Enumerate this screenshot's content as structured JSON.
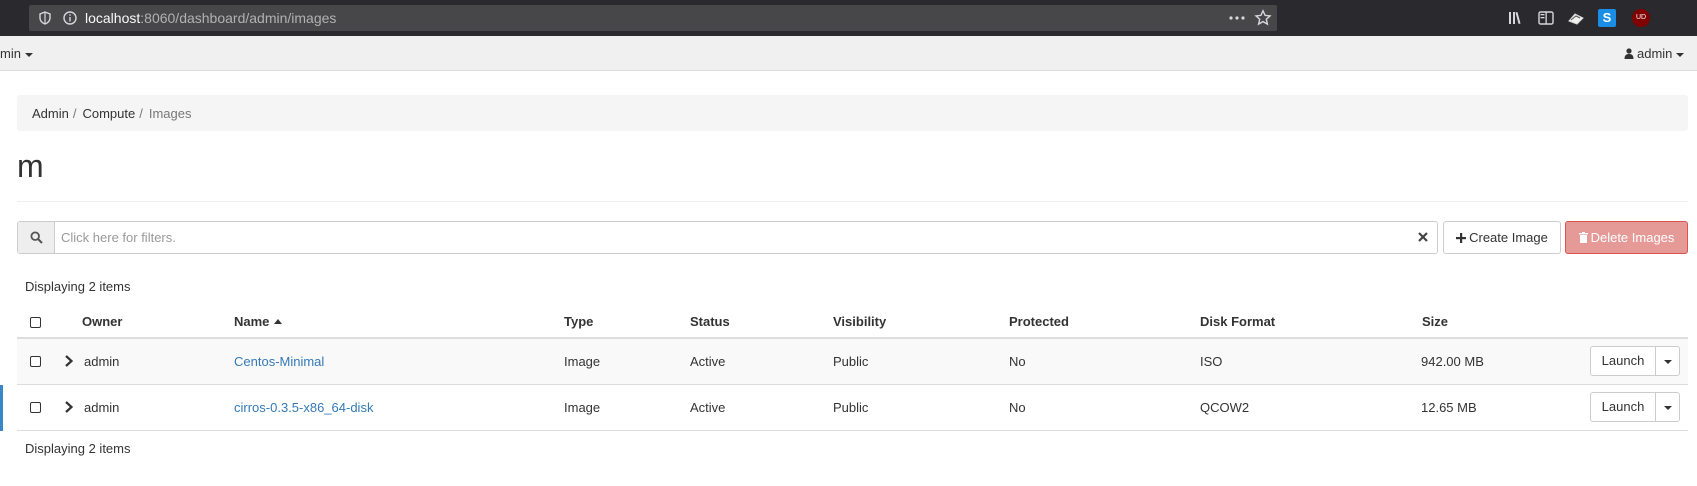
{
  "browser": {
    "url_host": "localhost",
    "url_rest": ":8060/dashboard/admin/images",
    "icons": [
      "shield-icon",
      "info-icon",
      "more-icon",
      "star-icon",
      "library-icon",
      "sidebar-icon",
      "extension-icon",
      "s-extension-icon",
      "ublock-icon"
    ],
    "ublock_badge": "UD"
  },
  "navbar": {
    "project_label": "min",
    "user_label": "admin"
  },
  "breadcrumb": {
    "items": [
      "Admin",
      "Compute",
      "Images"
    ]
  },
  "page": {
    "title": "m"
  },
  "filter": {
    "placeholder": "Click here for filters."
  },
  "actions": {
    "create_label": "Create Image",
    "delete_label": "Delete Images"
  },
  "table": {
    "count_label": "Displaying 2 items",
    "columns": [
      "Owner",
      "Name",
      "Type",
      "Status",
      "Visibility",
      "Protected",
      "Disk Format",
      "Size"
    ],
    "sorted_column": "Name",
    "rows": [
      {
        "owner": "admin",
        "name": "Centos-Minimal",
        "type": "Image",
        "status": "Active",
        "visibility": "Public",
        "protected": "No",
        "disk_format": "ISO",
        "size": "942.00 MB",
        "action": "Launch"
      },
      {
        "owner": "admin",
        "name": "cirros-0.3.5-x86_64-disk",
        "type": "Image",
        "status": "Active",
        "visibility": "Public",
        "protected": "No",
        "disk_format": "QCOW2",
        "size": "12.65 MB",
        "action": "Launch"
      }
    ]
  },
  "colors": {
    "link": "#337ab7",
    "danger_disabled": "#e69a98",
    "browser_bg": "#2a2a2e"
  }
}
